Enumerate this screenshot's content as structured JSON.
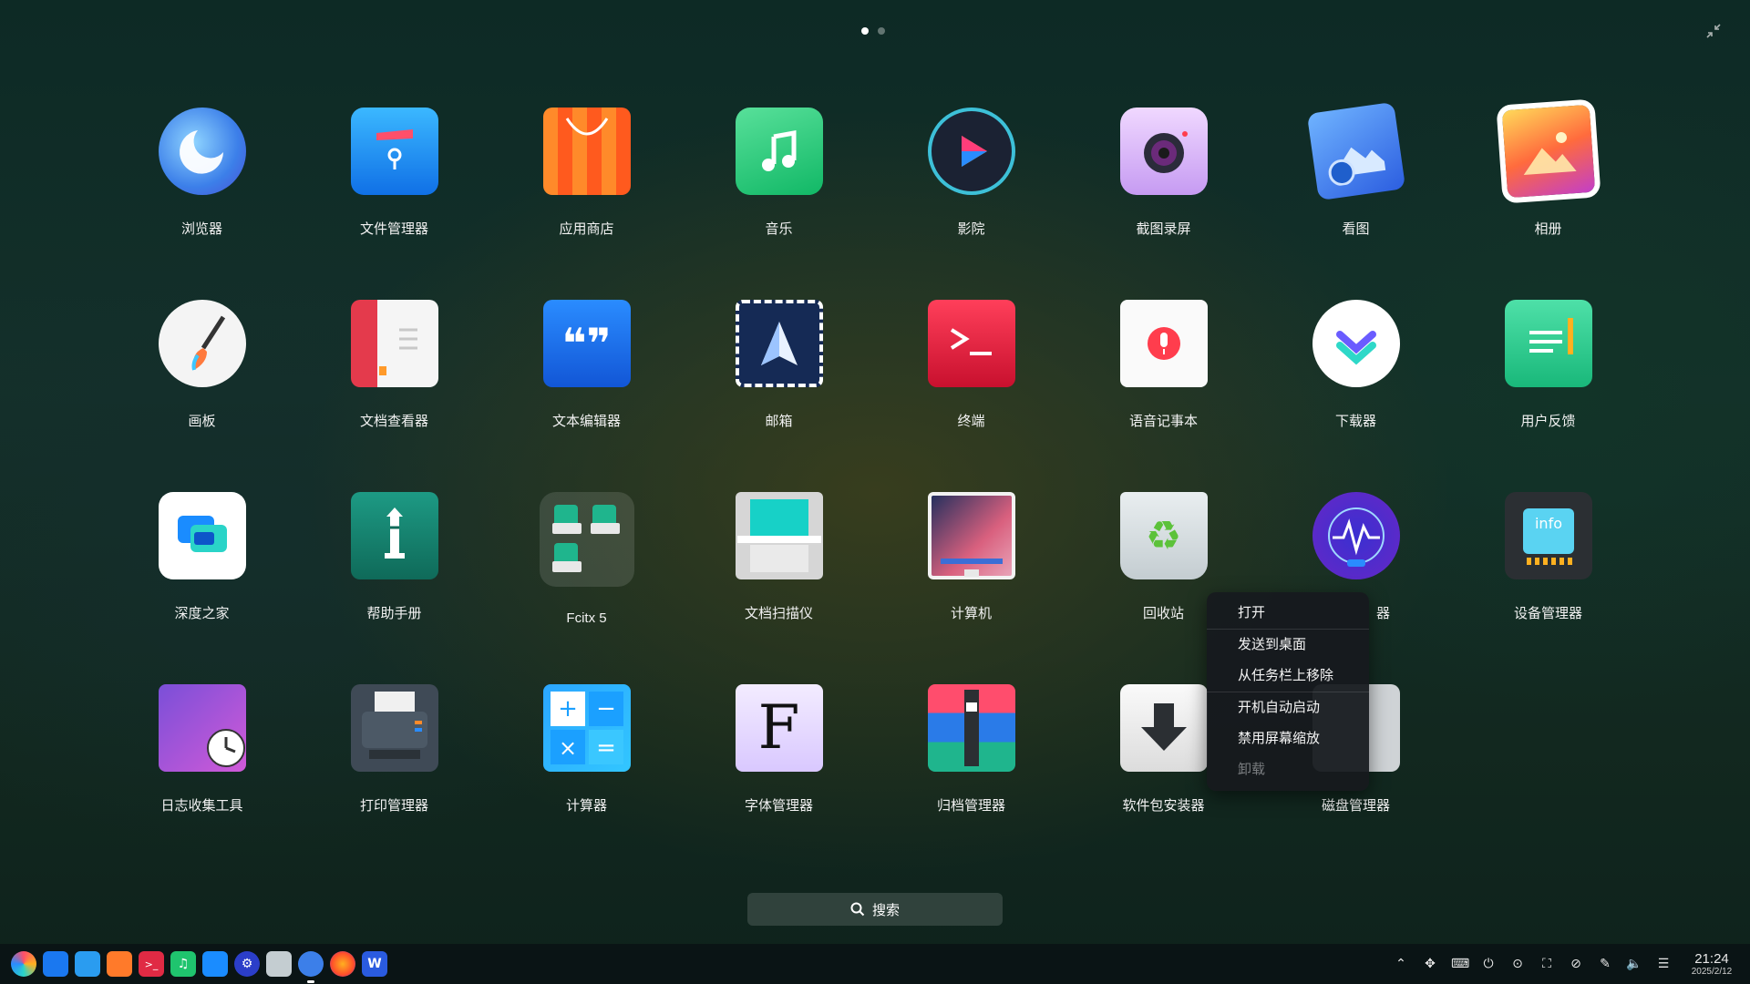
{
  "pager": {
    "pages": 2,
    "current": 1
  },
  "apps": [
    {
      "label": "浏览器",
      "icon": "browser-icon"
    },
    {
      "label": "文件管理器",
      "icon": "file-manager-icon"
    },
    {
      "label": "应用商店",
      "icon": "app-store-icon"
    },
    {
      "label": "音乐",
      "icon": "music-icon"
    },
    {
      "label": "影院",
      "icon": "movie-icon"
    },
    {
      "label": "截图录屏",
      "icon": "camera-icon"
    },
    {
      "label": "看图",
      "icon": "image-viewer-icon"
    },
    {
      "label": "相册",
      "icon": "album-icon"
    },
    {
      "label": "画板",
      "icon": "draw-icon"
    },
    {
      "label": "文档查看器",
      "icon": "document-viewer-icon"
    },
    {
      "label": "文本编辑器",
      "icon": "text-editor-icon"
    },
    {
      "label": "邮箱",
      "icon": "mail-icon"
    },
    {
      "label": "终端",
      "icon": "terminal-icon"
    },
    {
      "label": "语音记事本",
      "icon": "voice-note-icon"
    },
    {
      "label": "下载器",
      "icon": "downloader-icon"
    },
    {
      "label": "用户反馈",
      "icon": "feedback-icon"
    },
    {
      "label": "深度之家",
      "icon": "deepin-home-icon"
    },
    {
      "label": "帮助手册",
      "icon": "help-manual-icon"
    },
    {
      "label": "Fcitx 5",
      "icon": "fcitx-folder-icon"
    },
    {
      "label": "文档扫描仪",
      "icon": "scanner-icon"
    },
    {
      "label": "计算机",
      "icon": "computer-icon"
    },
    {
      "label": "回收站",
      "icon": "trash-icon"
    },
    {
      "label": "器",
      "icon": "system-monitor-icon"
    },
    {
      "label": "设备管理器",
      "icon": "device-manager-icon"
    },
    {
      "label": "日志收集工具",
      "icon": "log-collector-icon"
    },
    {
      "label": "打印管理器",
      "icon": "print-manager-icon"
    },
    {
      "label": "计算器",
      "icon": "calculator-icon"
    },
    {
      "label": "字体管理器",
      "icon": "font-manager-icon"
    },
    {
      "label": "归档管理器",
      "icon": "archive-manager-icon"
    },
    {
      "label": "软件包安装器",
      "icon": "package-installer-icon"
    },
    {
      "label": "磁盘管理器",
      "icon": "disk-manager-icon"
    }
  ],
  "search": {
    "label": "搜索"
  },
  "context_menu": {
    "items": [
      {
        "label": "打开",
        "enabled": true
      },
      {
        "label": "发送到桌面",
        "enabled": true
      },
      {
        "label": "从任务栏上移除",
        "enabled": true
      },
      {
        "label": "开机自动启动",
        "enabled": true
      },
      {
        "label": "禁用屏幕缩放",
        "enabled": true
      },
      {
        "label": "卸载",
        "enabled": false
      }
    ]
  },
  "taskbar": {
    "apps": [
      "launcher-icon",
      "file-manager-icon",
      "app-store-icon",
      "store-icon",
      "terminal-icon",
      "music-icon",
      "deepin-home-icon",
      "settings-icon",
      "trash-icon",
      "browser-icon",
      "firefox-icon",
      "wps-writer-icon"
    ],
    "clock_time": "21:24",
    "clock_date": "2025/2/12"
  },
  "colors": {
    "accent": "#2a7be8",
    "menu_bg": "#161a1e"
  }
}
